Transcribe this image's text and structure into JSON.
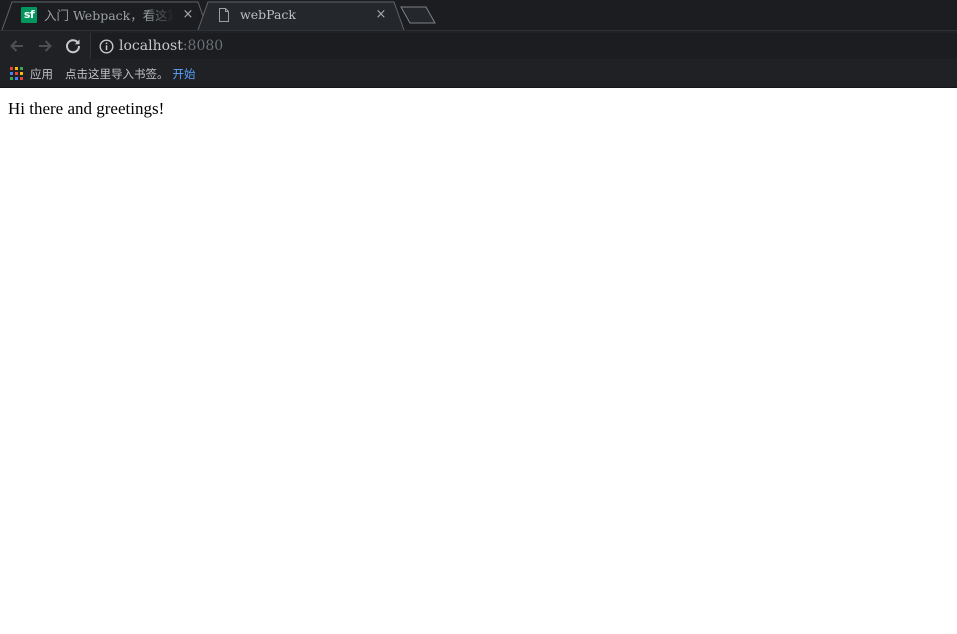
{
  "tabs": [
    {
      "title": "入门 Webpack，看这篇就够了",
      "favicon": "sf",
      "close": "×",
      "active": false
    },
    {
      "title": "webPack",
      "favicon": "page-icon",
      "close": "×",
      "active": true
    }
  ],
  "toolbar": {
    "back_icon": "arrow-left-icon",
    "forward_icon": "arrow-right-icon",
    "reload_icon": "reload-icon",
    "info_icon": "info-icon",
    "url_host": "localhost",
    "url_port": ":8080"
  },
  "bookmarks": {
    "apps_label": "应用",
    "hint": "点击这里导入书签。",
    "start_link": "开始",
    "apps_colors": [
      "#ea4335",
      "#fbbc05",
      "#34a853",
      "#4285f4",
      "#ea4335",
      "#fbbc05",
      "#34a853",
      "#4285f4",
      "#ea4335"
    ]
  },
  "page": {
    "greeting": "Hi there and greetings!"
  },
  "colors": {
    "chrome_dark": "#1f2124",
    "tab_strip": "#1b1d20",
    "link_blue": "#5aa2ff",
    "sf_green": "#00965e"
  }
}
